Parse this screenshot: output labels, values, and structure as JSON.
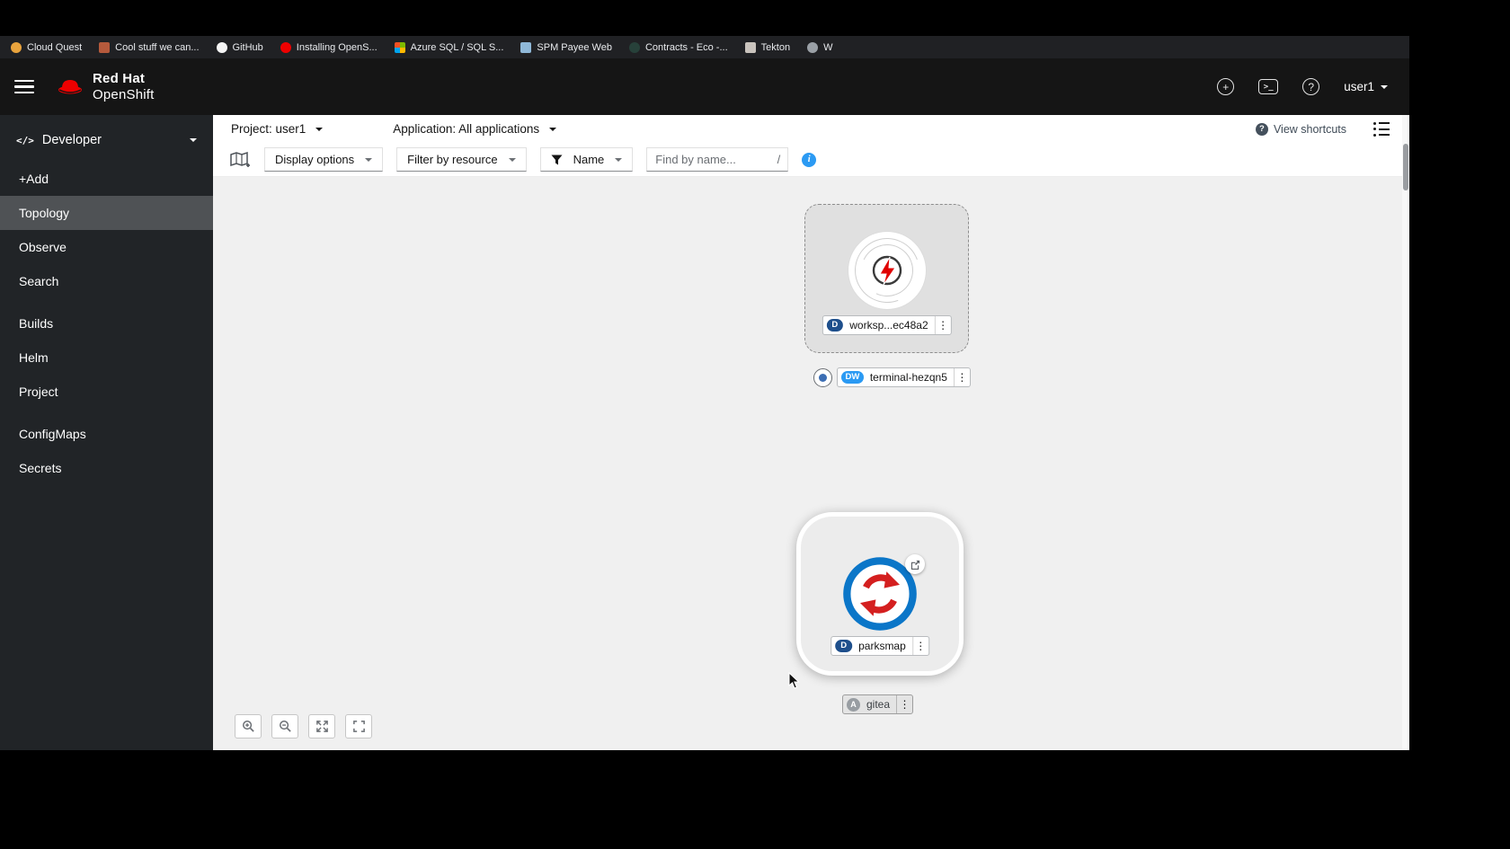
{
  "bookmarks": {
    "items": [
      {
        "label": "Cloud Quest",
        "icon": "cloud-quest-favicon"
      },
      {
        "label": "Cool stuff we can...",
        "icon": "bookmark-favicon"
      },
      {
        "label": "GitHub",
        "icon": "github-favicon"
      },
      {
        "label": "Installing OpenS...",
        "icon": "openshift-favicon"
      },
      {
        "label": "Azure SQL / SQL S...",
        "icon": "microsoft-favicon"
      },
      {
        "label": "SPM Payee Web",
        "icon": "web-favicon"
      },
      {
        "label": "Contracts - Eco -...",
        "icon": "contracts-favicon"
      },
      {
        "label": "Tekton",
        "icon": "tekton-favicon"
      },
      {
        "label": "W",
        "icon": "globe-favicon"
      }
    ]
  },
  "masthead": {
    "brand_line1": "Red Hat",
    "brand_line2": "OpenShift",
    "user": "user1"
  },
  "sidebar": {
    "perspective": "Developer",
    "items": [
      {
        "label": "+Add"
      },
      {
        "label": "Topology",
        "selected": true
      },
      {
        "label": "Observe"
      },
      {
        "label": "Search"
      },
      {
        "label": "Builds"
      },
      {
        "label": "Helm"
      },
      {
        "label": "Project"
      },
      {
        "label": "ConfigMaps"
      },
      {
        "label": "Secrets"
      }
    ]
  },
  "context_bar": {
    "project": "Project: user1",
    "application": "Application: All applications",
    "view_shortcuts": "View shortcuts"
  },
  "toolbar": {
    "display_options": "Display options",
    "filter_by_resource": "Filter by resource",
    "name_filter": "Name",
    "find_placeholder": "Find by name...",
    "shortcut_key": "/"
  },
  "topology": {
    "workspace_node": {
      "badge": "D",
      "label": "worksp...ec48a2"
    },
    "terminal_label": {
      "badge": "DW",
      "label": "terminal-hezqn5"
    },
    "parksmap_node": {
      "badge": "D",
      "label": "parksmap"
    },
    "gitea_label": {
      "badge": "A",
      "label": "gitea"
    }
  },
  "icons": {
    "kebab": "⋮",
    "plus": "+",
    "help": "?",
    "terminal_glyph": ">_",
    "code": "</>",
    "info": "i"
  },
  "colors": {
    "accent": "#0066cc",
    "masthead_bg": "#151515",
    "sidebar_bg": "#212427",
    "selected_bg": "#4f5255",
    "canvas_bg": "#f0f0f0",
    "badge_navy": "#1e4f8c",
    "badge_blue": "#2b9af3",
    "bolt_red": "#e00000",
    "ring_blue": "#0b76c8",
    "arrows_red": "#d41f1f"
  }
}
